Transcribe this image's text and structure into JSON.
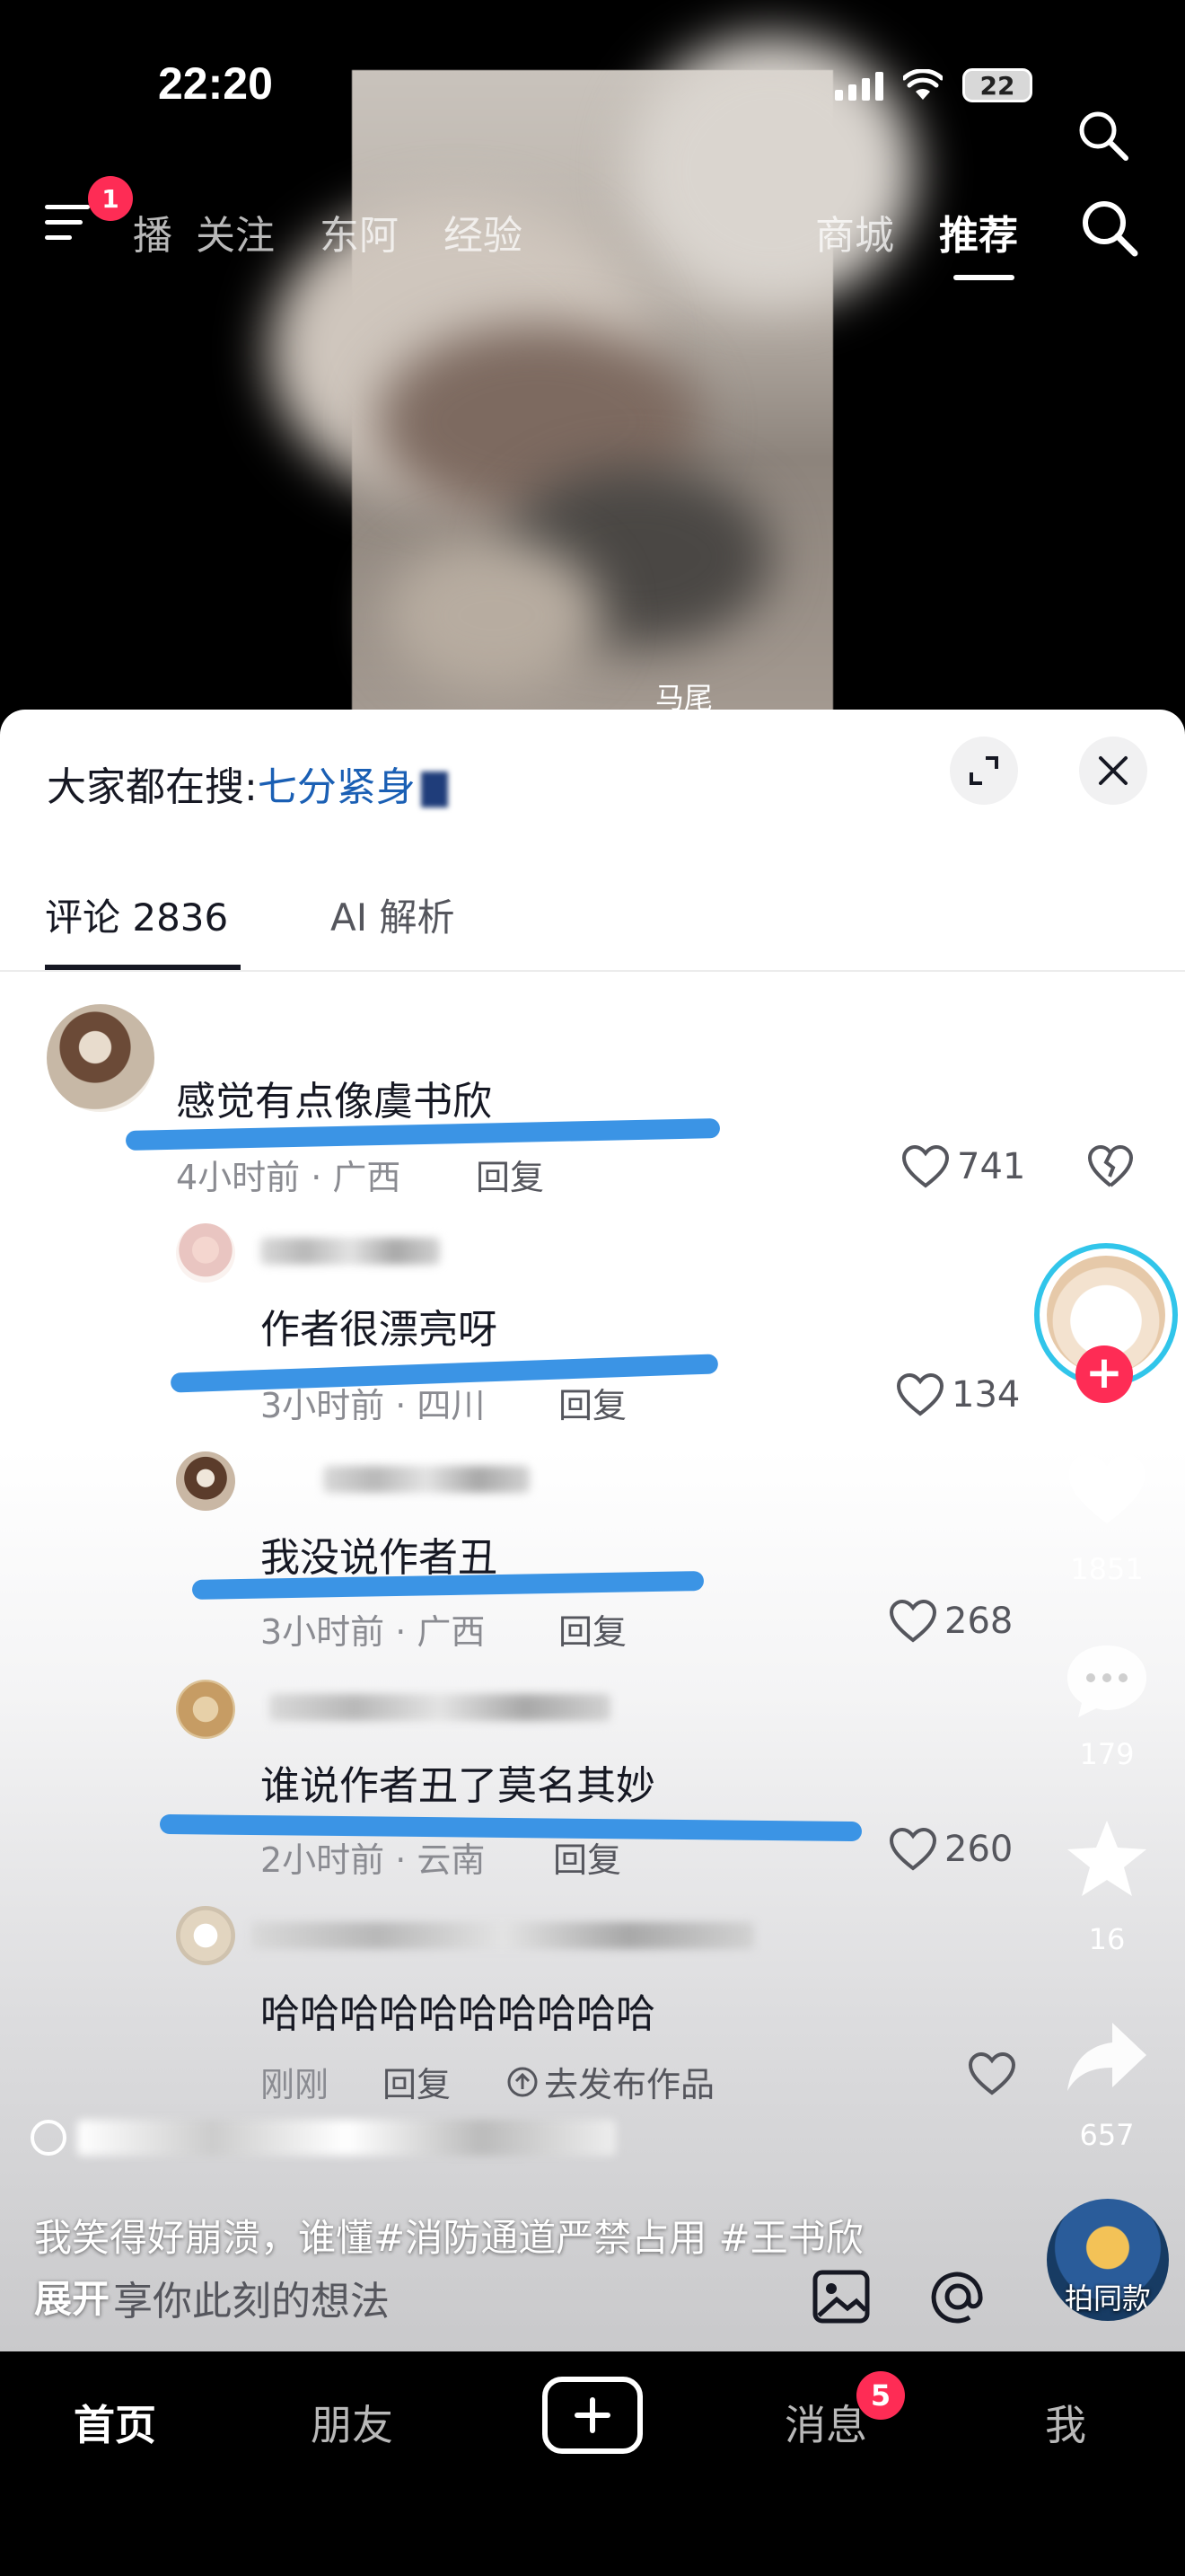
{
  "status_bar": {
    "time": "22:20",
    "battery": "22"
  },
  "top_nav": {
    "menu_badge": "1",
    "tabs": [
      "播",
      "关注",
      "东阿",
      "经验",
      "商城",
      "推荐"
    ],
    "active_tab": "推荐"
  },
  "video": {
    "overlay_text": "马尾"
  },
  "sheet": {
    "search_hint_prefix": "大家都在搜:",
    "search_hint_term": "七分紧身",
    "tabs": [
      "评论 2836",
      "AI 解析"
    ]
  },
  "comments": [
    {
      "text": "感觉有点像虞书欣",
      "time_loc": "4小时前 · 广西",
      "reply": "回复",
      "likes": "741"
    },
    {
      "text": "作者很漂亮呀",
      "time_loc": "3小时前 · 四川",
      "reply": "回复",
      "likes": "134"
    },
    {
      "text": "我没说作者丑",
      "time_loc": "3小时前 · 广西",
      "reply": "回复",
      "likes": "268"
    },
    {
      "text": "谁说作者丑了莫名其妙",
      "time_loc": "2小时前 · 云南",
      "reply": "回复",
      "likes": "260"
    },
    {
      "text": "哈哈哈哈哈哈哈哈哈哈",
      "time_loc": "刚刚",
      "reply": "回复",
      "publish": "去发布作品"
    }
  ],
  "rail": {
    "likes": "1851",
    "comments": "179",
    "favorites": "16",
    "shares": "657"
  },
  "caption": {
    "text": "我笑得好崩溃，谁懂#消防通道严禁占用 #王书欣",
    "expand": "展开",
    "composer_placeholder": "享你此刻的想法",
    "same_style": "拍同款"
  },
  "bottom_bar": {
    "tabs": [
      "首页",
      "朋友",
      "消息",
      "我"
    ],
    "messages_badge": "5"
  },
  "colors": {
    "accent": "#fe2c55",
    "link": "#1a5fb4",
    "scribble": "#3b94e5"
  }
}
